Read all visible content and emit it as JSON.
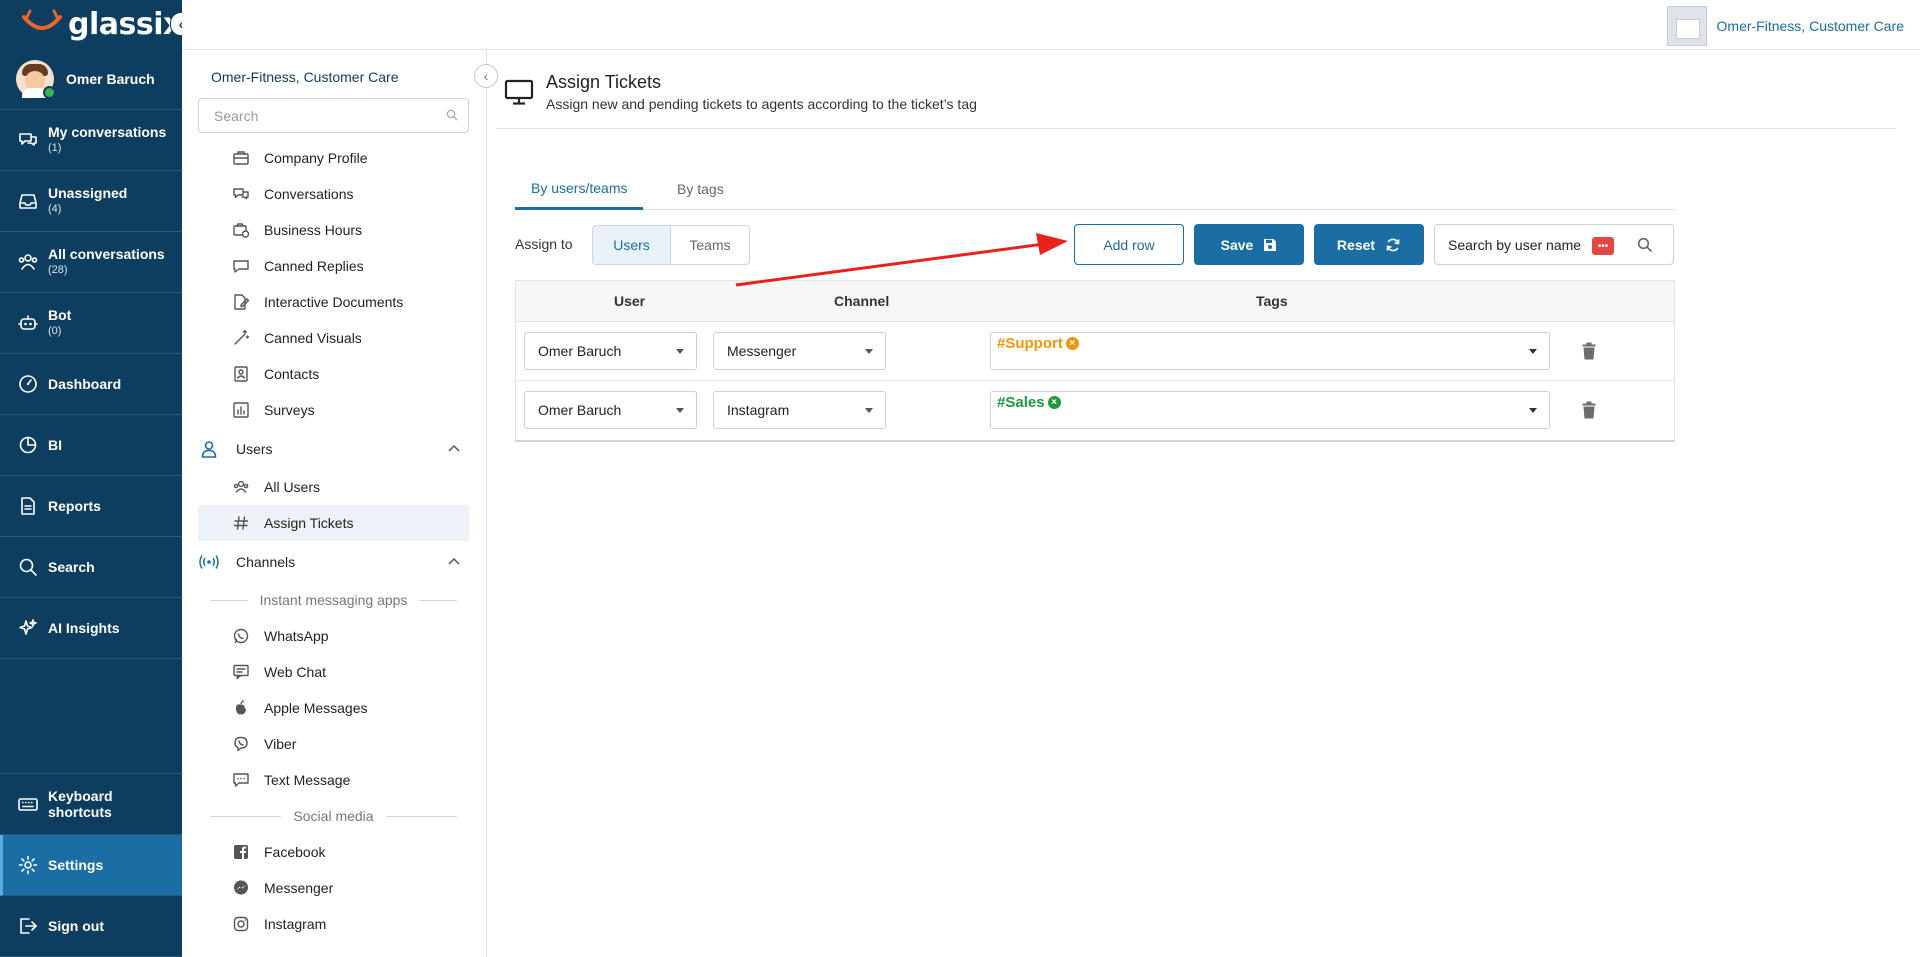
{
  "brand": {
    "name": "glassix"
  },
  "user": {
    "name": "Omer Baruch"
  },
  "nav": [
    {
      "label": "My conversations",
      "count": "(1)",
      "icon": "chat-bubbles-icon"
    },
    {
      "label": "Unassigned",
      "count": "(4)",
      "icon": "inbox-icon"
    },
    {
      "label": "All conversations",
      "count": "(28)",
      "icon": "users-group-icon"
    },
    {
      "label": "Bot",
      "count": "(0)",
      "icon": "robot-icon"
    },
    {
      "label": "Dashboard",
      "count": "",
      "icon": "gauge-icon"
    },
    {
      "label": "BI",
      "count": "",
      "icon": "pie-chart-icon"
    },
    {
      "label": "Reports",
      "count": "",
      "icon": "document-icon"
    },
    {
      "label": "Search",
      "count": "",
      "icon": "search-icon"
    },
    {
      "label": "AI Insights",
      "count": "",
      "icon": "sparkles-icon"
    }
  ],
  "nav_bottom": [
    {
      "label": "Keyboard shortcuts",
      "icon": "keyboard-icon"
    },
    {
      "label": "Settings",
      "icon": "gear-icon",
      "active": true
    },
    {
      "label": "Sign out",
      "icon": "sign-out-icon"
    }
  ],
  "topbar": {
    "company": "Omer-Fitness, Customer Care"
  },
  "settings": {
    "company": "Omer-Fitness, Customer Care",
    "search_placeholder": "Search",
    "items": [
      {
        "label": "Company Profile",
        "icon": "briefcase-icon"
      },
      {
        "label": "Conversations",
        "icon": "chat-bubbles-icon"
      },
      {
        "label": "Business Hours",
        "icon": "briefcase-clock-icon"
      },
      {
        "label": "Canned Replies",
        "icon": "chat-bubble-icon"
      },
      {
        "label": "Interactive Documents",
        "icon": "edit-document-icon"
      },
      {
        "label": "Canned Visuals",
        "icon": "magic-wand-icon"
      },
      {
        "label": "Contacts",
        "icon": "contacts-icon"
      },
      {
        "label": "Surveys",
        "icon": "bar-chart-icon"
      }
    ],
    "users_group": {
      "label": "Users",
      "icon": "user-icon"
    },
    "users_items": [
      {
        "label": "All Users",
        "icon": "users-group-icon"
      },
      {
        "label": "Assign Tickets",
        "icon": "hash-icon",
        "active": true
      }
    ],
    "channels_group": {
      "label": "Channels",
      "icon": "broadcast-icon"
    },
    "sep_im": "Instant messaging apps",
    "im_items": [
      {
        "label": "WhatsApp",
        "icon": "whatsapp-icon"
      },
      {
        "label": "Web Chat",
        "icon": "web-chat-icon"
      },
      {
        "label": "Apple Messages",
        "icon": "apple-icon"
      },
      {
        "label": "Viber",
        "icon": "viber-icon"
      },
      {
        "label": "Text Message",
        "icon": "sms-icon"
      }
    ],
    "sep_social": "Social media",
    "social_items": [
      {
        "label": "Facebook",
        "icon": "facebook-icon"
      },
      {
        "label": "Messenger",
        "icon": "messenger-icon"
      },
      {
        "label": "Instagram",
        "icon": "instagram-icon"
      }
    ]
  },
  "page": {
    "title": "Assign Tickets",
    "subtitle": "Assign new and pending tickets to agents according to the ticket’s tag",
    "tabs": [
      "By users/teams",
      "By tags"
    ],
    "assign_to_label": "Assign to",
    "assign_options": [
      "Users",
      "Teams"
    ],
    "add_row": "Add row",
    "save": "Save",
    "reset": "Reset",
    "search_label": "Search by user name",
    "columns": [
      "User",
      "Channel",
      "Tags"
    ],
    "rows": [
      {
        "user": "Omer Baruch",
        "channel": "Messenger",
        "tag": "#Support",
        "tag_color": "#f0960a"
      },
      {
        "user": "Omer Baruch",
        "channel": "Instagram",
        "tag": "#Sales",
        "tag_color": "#1e9a3c"
      }
    ]
  },
  "colors": {
    "nav_bg": "#0d3d5f",
    "accent": "#1a6ea3",
    "active_nav": "#1a6ea3",
    "annotation_arrow": "#e8211d"
  }
}
